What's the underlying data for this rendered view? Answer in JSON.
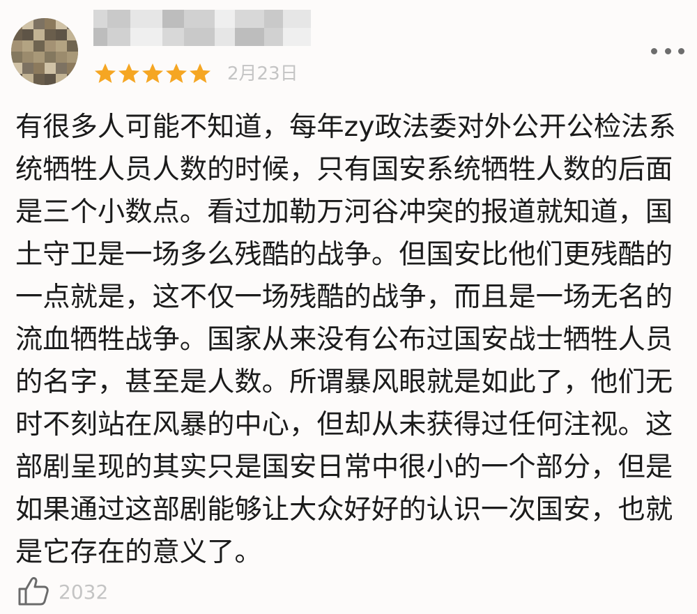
{
  "review": {
    "date": "2月23日",
    "rating": 5,
    "rating_max": 5,
    "star_color": "#f5a623",
    "text": "有很多人可能不知道，每年zy政法委对外公开公检法系统牺牲人员人数的时候，只有国安系统牺牲人数的后面是三个小数点。看过加勒万河谷冲突的报道就知道，国土守卫是一场多么残酷的战争。但国安比他们更残酷的一点就是，这不仅一场残酷的战争，而且是一场无名的流血牺牲战争。国家从来没有公布过国安战士牺牲人员的名字，甚至是人数。所谓暴风眼就是如此了，他们无时不刻站在风暴的中心，但却从未获得过任何注视。这部剧呈现的其实只是国安日常中很小的一个部分，但是如果通过这部剧能够让大众好好的认识一次国安，也就是它存在的意义了。",
    "like_count": "2032"
  },
  "icons": {
    "avatar": "blurred-avatar",
    "username": "blurred-username",
    "more": "more-dots-icon",
    "like": "thumbs-up-icon",
    "star": "star-icon"
  }
}
